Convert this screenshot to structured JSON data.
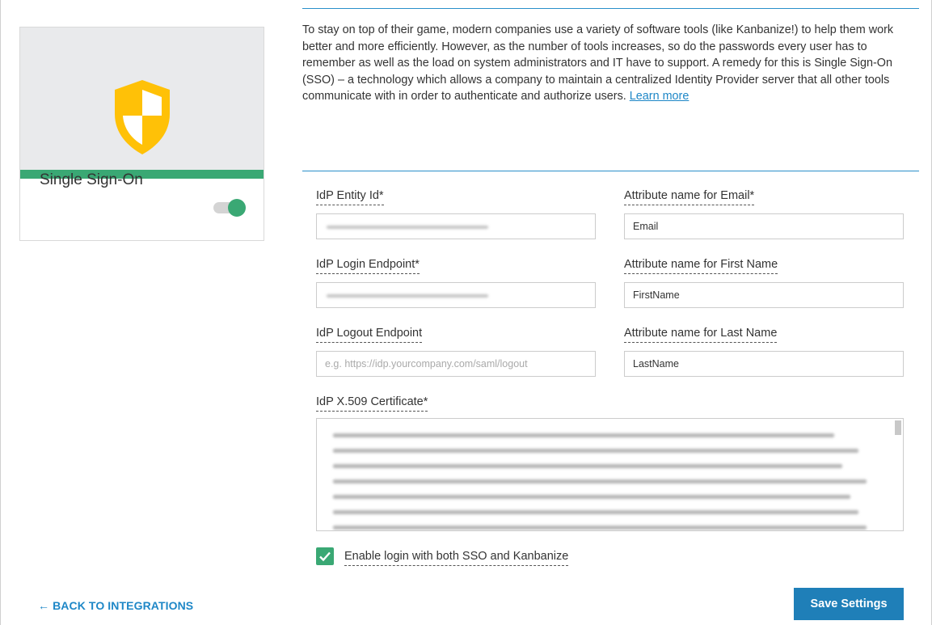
{
  "integration": {
    "title": "Single Sign-On",
    "enabled": true,
    "icon": "shield-icon",
    "accent_color": "#3aa874",
    "shield_color": "#ffc107"
  },
  "description": {
    "text": "To stay on top of their game, modern companies use a variety of software tools (like Kanbanize!) to help them work better and more efficiently. However, as the number of tools increases, so do the passwords every user has to remember as well as the load on system administrators and IT have to support. A remedy for this is Single Sign-On (SSO) – a technology which allows a company to maintain a centralized Identity Provider server that all other tools communicate with in order to authenticate and authorize users.",
    "learn_more": "Learn more"
  },
  "form": {
    "idp_entity_id": {
      "label": "IdP Entity Id*",
      "value": ""
    },
    "idp_login_endpoint": {
      "label": "IdP Login Endpoint*",
      "value": ""
    },
    "idp_logout_endpoint": {
      "label": "IdP Logout Endpoint",
      "placeholder": "e.g. https://idp.yourcompany.com/saml/logout",
      "value": ""
    },
    "attr_email": {
      "label": "Attribute name for Email*",
      "value": "Email"
    },
    "attr_first_name": {
      "label": "Attribute name for First Name",
      "value": "FirstName"
    },
    "attr_last_name": {
      "label": "Attribute name for Last Name",
      "value": "LastName"
    },
    "certificate": {
      "label": "IdP X.509 Certificate*"
    },
    "enable_both": {
      "label": "Enable login with both SSO and Kanbanize",
      "checked": true
    }
  },
  "actions": {
    "back_label": "← BACK TO INTEGRATIONS",
    "save_label": "Save Settings",
    "primary_color": "#1f7fb8"
  }
}
